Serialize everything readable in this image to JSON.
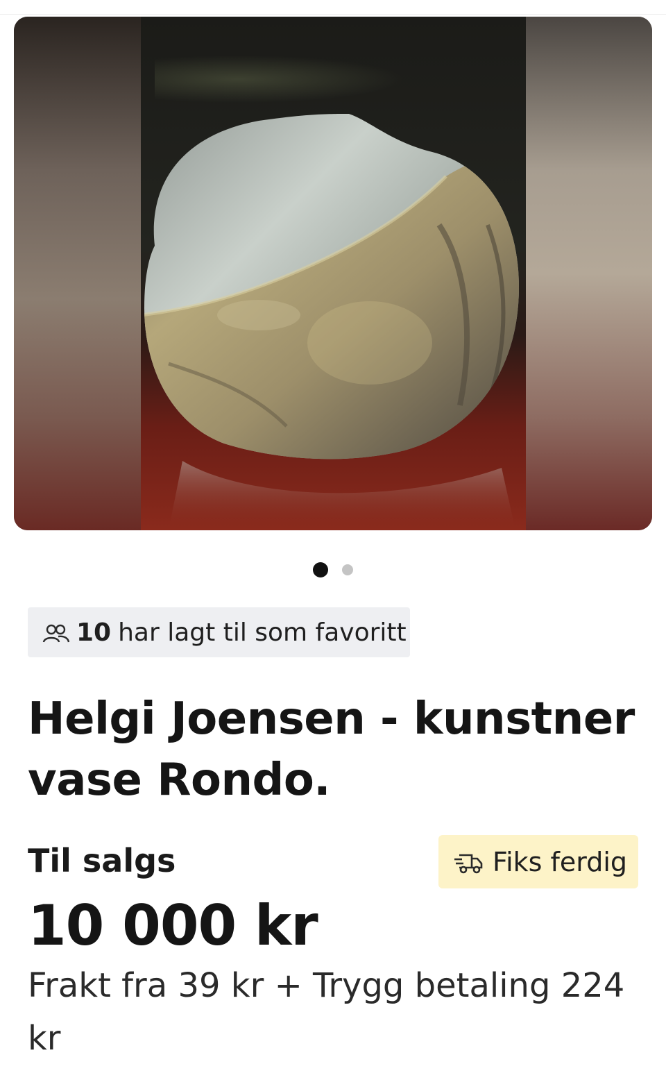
{
  "gallery": {
    "image_alt": "Helgi Joensen - kunstner vase Rondo.",
    "pager_total": 2,
    "pager_active": 1
  },
  "favorites": {
    "icon": "people-icon",
    "count": "10",
    "text": "har lagt til som favoritt"
  },
  "listing": {
    "title": "Helgi Joensen - kunstner vase Rondo.",
    "status": "Til salgs",
    "badge": {
      "icon": "delivery-truck-icon",
      "label": "Fiks ferdig",
      "color": "#fdf3c8"
    },
    "price": "10 000 kr",
    "shipping_text": "Frakt fra 39 kr + Trygg betaling 224 kr"
  }
}
